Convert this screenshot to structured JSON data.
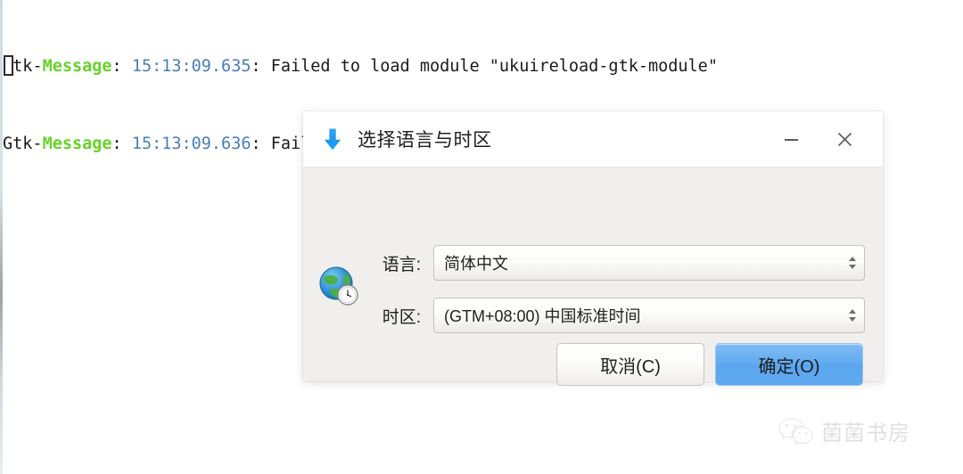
{
  "terminal": {
    "lines": [
      {
        "tag": "Gtk-",
        "level": "Message",
        "colon": ": ",
        "time": "15:13:09.635",
        "message": ": Failed to load module \"ukuireload-gtk-module\""
      },
      {
        "tag": "Gtk-",
        "level": "Message",
        "colon": ": ",
        "time": "15:13:09.636",
        "message": ": Failed to load module \"canberra-gtk-module\""
      }
    ],
    "cursor_icon": "block-cursor",
    "colors": {
      "tag": "#1a1a1a",
      "level": "#68d22c",
      "time": "#4a7ebb",
      "message": "#1a1a1a"
    }
  },
  "dialog": {
    "title": "选择语言与时区",
    "title_icon": "download-arrow-icon",
    "form_icon": "globe-clock-icon",
    "window_controls": {
      "minimize_icon": "minimize-icon",
      "close_icon": "close-icon"
    },
    "fields": [
      {
        "label": "语言:",
        "value": "简体中文",
        "name": "language",
        "spinner_icon": "spinner-updown-icon"
      },
      {
        "label": "时区:",
        "value": "(GTM+08:00) 中国标准时间",
        "name": "timezone",
        "spinner_icon": "spinner-updown-icon"
      }
    ],
    "buttons": {
      "cancel": "取消(C)",
      "ok": "确定(O)"
    },
    "accent_color": "#5ba6ef",
    "background": "#f0efed",
    "titlebar_background": "#ffffff"
  },
  "watermark": {
    "text": "菌菌书房",
    "icon": "wechat-icon"
  }
}
